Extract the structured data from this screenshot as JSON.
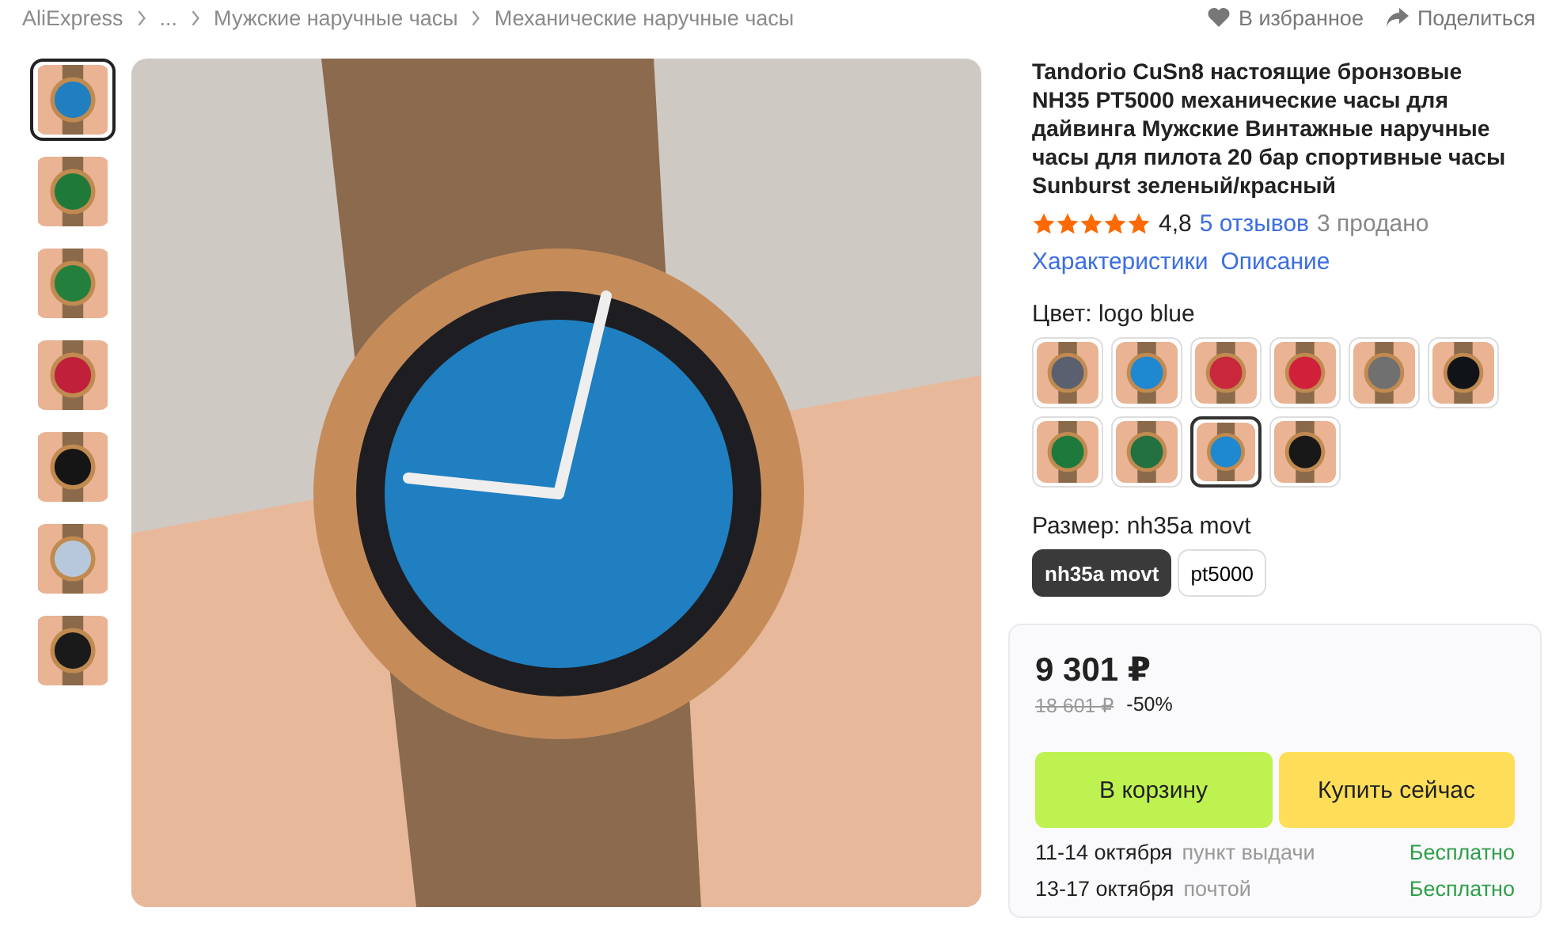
{
  "breadcrumbs": [
    "AliExpress",
    "...",
    "Мужские наручные часы",
    "Механические наручные часы"
  ],
  "actions": [
    {
      "kind": "favorite",
      "label": "В избранное"
    },
    {
      "kind": "share",
      "label": "Поделиться"
    }
  ],
  "gallery": {
    "thumbnails": [
      {
        "selected": true,
        "color": "#1f7fc0"
      },
      {
        "selected": false,
        "color": "#1f7a3a"
      },
      {
        "selected": false,
        "color": "#23803c"
      },
      {
        "selected": false,
        "color": "#c0203a"
      },
      {
        "selected": false,
        "color": "#151515"
      },
      {
        "selected": false,
        "color": "#b8c8dc"
      },
      {
        "selected": false,
        "color": "#1a1a1a"
      }
    ]
  },
  "product": {
    "title": "Tandorio CuSn8 настоящие бронзовые NH35 PT5000 механические часы для дайвинга Мужские Винтажные наручные часы для пилота 20 бар спортивные часы Sunburst зеленый/красный",
    "stars": 5,
    "rating": "4,8",
    "reviews": "5 отзывов",
    "sold": "3 продано",
    "links": [
      "Характеристики",
      "Описание"
    ]
  },
  "color_option": {
    "label": "Цвет: logo blue",
    "swatches": [
      {
        "selected": false,
        "color": "#5a6070"
      },
      {
        "selected": false,
        "color": "#1e88d0"
      },
      {
        "selected": false,
        "color": "#c8283a"
      },
      {
        "selected": false,
        "color": "#d0203a"
      },
      {
        "selected": false,
        "color": "#707070"
      },
      {
        "selected": false,
        "color": "#101418"
      },
      {
        "selected": false,
        "color": "#1e7a3c"
      },
      {
        "selected": false,
        "color": "#237040"
      },
      {
        "selected": true,
        "color": "#1e88d0"
      },
      {
        "selected": false,
        "color": "#181818"
      }
    ]
  },
  "size_option": {
    "label": "Размер: nh35a movt",
    "options": [
      {
        "label": "nh35a movt",
        "selected": true
      },
      {
        "label": "pt5000",
        "selected": false
      }
    ]
  },
  "purchase": {
    "price": "9 301 ₽",
    "old_price": "18 601 ₽",
    "discount": "-50%",
    "buttons": [
      {
        "kind": "cart",
        "label": "В корзину"
      },
      {
        "kind": "buy",
        "label": "Купить сейчас"
      }
    ],
    "delivery": [
      {
        "date": "11-14 октября",
        "method": "пункт выдачи",
        "cost": "Бесплатно"
      },
      {
        "date": "13-17 октября",
        "method": "почтой",
        "cost": "Бесплатно"
      }
    ]
  }
}
